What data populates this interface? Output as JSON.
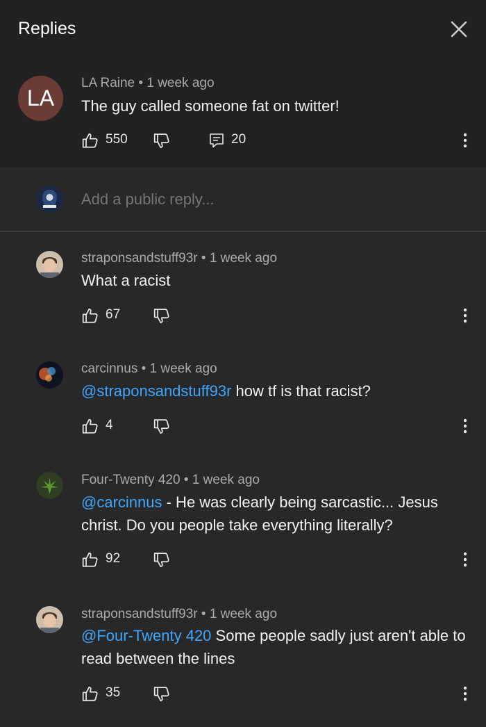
{
  "header": {
    "title": "Replies"
  },
  "parent_comment": {
    "avatar_initials": "LA",
    "author": "LA Raine",
    "time": "1 week ago",
    "text": "The guy called someone fat on twitter!",
    "likes": "550",
    "replies": "20"
  },
  "add_reply": {
    "placeholder": "Add a public reply..."
  },
  "replies": [
    {
      "author": "straponsandstuff93r",
      "time": "1 week ago",
      "mention": "",
      "text": "What a racist",
      "likes": "67"
    },
    {
      "author": "carcinnus",
      "time": "1 week ago",
      "mention": "@straponsandstuff93r",
      "text": " how tf is that racist?",
      "likes": "4"
    },
    {
      "author": "Four-Twenty 420",
      "time": "1 week ago",
      "mention": "@carcinnus",
      "text": " - He was clearly being sarcastic... Jesus christ. Do you people take everything literally?",
      "likes": "92"
    },
    {
      "author": "straponsandstuff93r",
      "time": "1 week ago",
      "mention": "@Four-Twenty 420",
      "text": " Some people sadly just aren't able to read between the lines",
      "likes": "35"
    }
  ],
  "colors": {
    "background": "#282828",
    "header": "#212121",
    "mention": "#3ea6ff",
    "meta": "#aaaaaa"
  }
}
